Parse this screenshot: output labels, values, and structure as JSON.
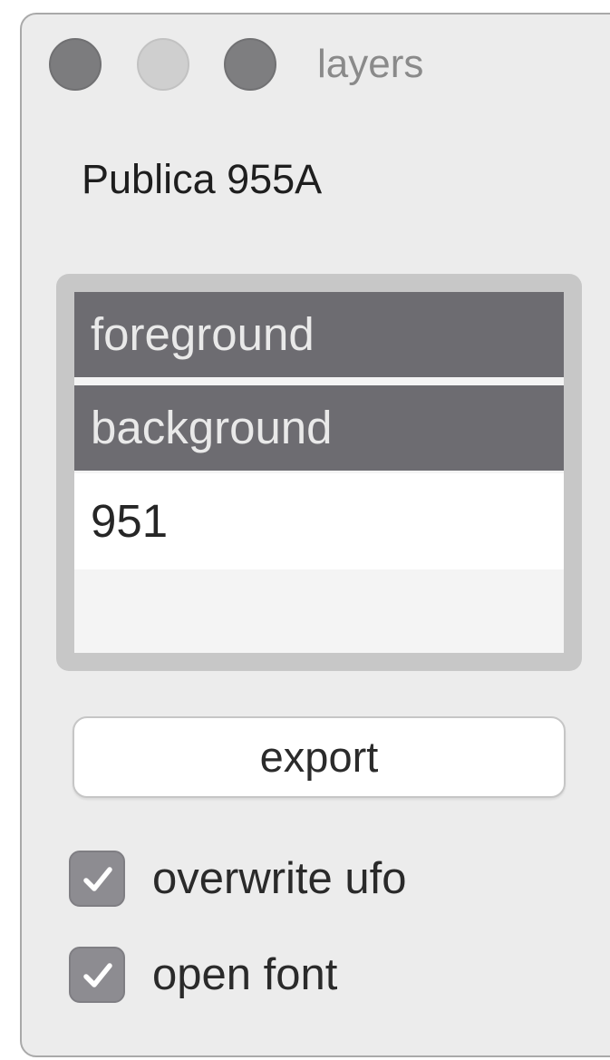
{
  "window": {
    "title": "layers"
  },
  "font_name": "Publica 955A",
  "layers": {
    "items": [
      {
        "label": "foreground",
        "selected": true
      },
      {
        "label": "background",
        "selected": true
      },
      {
        "label": "951",
        "selected": false
      }
    ]
  },
  "export_label": "export",
  "options": [
    {
      "label": "overwrite ufo",
      "checked": true,
      "icon": "checkmark-icon"
    },
    {
      "label": "open font",
      "checked": true,
      "icon": "checkmark-icon"
    }
  ],
  "colors": {
    "selection": "#6d6c71",
    "checkbox": "#8d8c91",
    "window_bg": "#ececec"
  }
}
